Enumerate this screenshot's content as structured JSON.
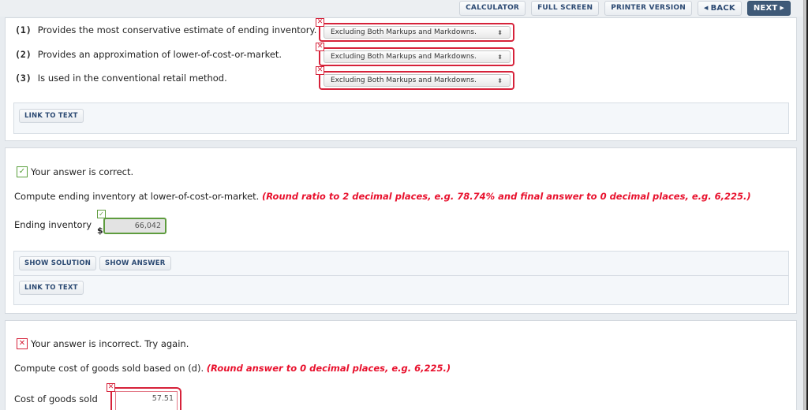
{
  "nav": {
    "calculator": "CALCULATOR",
    "full_screen": "FULL SCREEN",
    "printer_version": "PRINTER VERSION",
    "back": "BACK",
    "next": "NEXT",
    "back_icon": "◀",
    "next_icon": "▶"
  },
  "section1": {
    "questions": [
      {
        "number": "(1)",
        "text": "Provides the most conservative estimate of ending inventory.",
        "selected": "Excluding Both Markups and Markdowns.",
        "status": "incorrect"
      },
      {
        "number": "(2)",
        "text": "Provides an approximation of lower-of-cost-or-market.",
        "selected": "Excluding Both Markups and Markdowns.",
        "status": "incorrect"
      },
      {
        "number": "(3)",
        "text": "Is used in the conventional retail method.",
        "selected": "Excluding Both Markups and Markdowns.",
        "status": "incorrect"
      }
    ],
    "link_to_text": "LINK TO TEXT"
  },
  "section2": {
    "status": "Your answer is correct.",
    "instruction": "Compute ending inventory at lower-of-cost-or-market.",
    "instruction_note": "(Round ratio to 2 decimal places, e.g. 78.74% and final answer to 0 decimal places, e.g. 6,225.)",
    "field_label": "Ending inventory",
    "currency": "$",
    "value": "66,042",
    "show_solution": "SHOW SOLUTION",
    "show_answer": "SHOW ANSWER",
    "link_to_text": "LINK TO TEXT"
  },
  "section3": {
    "status": "Your answer is incorrect.  Try again.",
    "instruction": "Compute cost of goods sold based on (d).",
    "instruction_note": "(Round answer to 0 decimal places, e.g. 6,225.)",
    "field_label": "Cost of goods sold",
    "value": "57.51"
  },
  "icons": {
    "check": "✓",
    "cross": "✕",
    "select_arrows": "⬍"
  },
  "colors": {
    "error": "#d6223a",
    "success": "#5e9c3e",
    "note_red": "#e8112d",
    "nav_next": "#3f5a78"
  }
}
